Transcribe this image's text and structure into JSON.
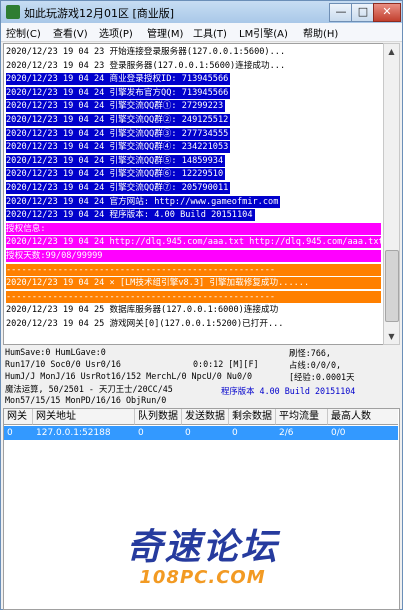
{
  "window": {
    "title": "如此玩游戏12月01区 [商业版]",
    "min": "—",
    "max": "□",
    "close": "✕"
  },
  "menu": [
    "控制(C)",
    "查看(V)",
    "选项(P)",
    "管理(M)",
    "工具(T)",
    "LM引擎(A)",
    "帮助(H)"
  ],
  "log": [
    {
      "text": "2020/12/23 19 04 23 开始连接登录服务器(127.0.0.1:5600)...",
      "fg": "#000000",
      "bg": ""
    },
    {
      "text": "2020/12/23 19 04 23 登录服务器(127.0.0.1:5600)连接成功...",
      "fg": "#000000",
      "bg": ""
    },
    {
      "text": "2020/12/23 19 04 24 商业登录授权ID: 713945566",
      "fg": "#ffffff",
      "bg": "#0000cc"
    },
    {
      "text": "2020/12/23 19 04 24 引擎发布官方QQ: 713945566",
      "fg": "#ffffff",
      "bg": "#0000cc"
    },
    {
      "text": "2020/12/23 19 04 24 引擎交流QQ群①: 27299223",
      "fg": "#ffffff",
      "bg": "#0000cc"
    },
    {
      "text": "2020/12/23 19 04 24 引擎交流QQ群②: 249125512",
      "fg": "#ffffff",
      "bg": "#0000cc"
    },
    {
      "text": "2020/12/23 19 04 24 引擎交流QQ群③: 277734555",
      "fg": "#ffffff",
      "bg": "#0000cc"
    },
    {
      "text": "2020/12/23 19 04 24 引擎交流QQ群④: 234221053",
      "fg": "#ffffff",
      "bg": "#0000cc"
    },
    {
      "text": "2020/12/23 19 04 24 引擎交流QQ群⑤: 14859934",
      "fg": "#ffffff",
      "bg": "#0000cc"
    },
    {
      "text": "2020/12/23 19 04 24 引擎交流QQ群⑥: 12229510",
      "fg": "#ffffff",
      "bg": "#0000cc"
    },
    {
      "text": "2020/12/23 19 04 24 引擎交流QQ群⑦: 205790011",
      "fg": "#ffffff",
      "bg": "#0000cc"
    },
    {
      "text": "2020/12/23 19 04 24 官方网站: http://www.gameofmir.com",
      "fg": "#ffffff",
      "bg": "#0000cc"
    },
    {
      "text": "2020/12/23 19 04 24 程序版本: 4.00 Build 20151104",
      "fg": "#ffffff",
      "bg": "#0000cc"
    },
    {
      "text": "授权信息:",
      "fg": "#ffffff",
      "bg": "#ff00ff"
    },
    {
      "text": "2020/12/23 19 04 24 http://dlq.945.com/aaa.txt http://dlq.945.com/aaa.txt",
      "fg": "#ffffff",
      "bg": "#ff00ff"
    },
    {
      "text": "授权天数:99/08/99999",
      "fg": "#ffffff",
      "bg": "#ff00ff"
    },
    {
      "text": "----------------------------------------------------",
      "fg": "#ffffff",
      "bg": "#ff8000"
    },
    {
      "text": "2020/12/23 19 04 24 × [LM技术组引擎v8.3] 引擎加载修复成功......",
      "fg": "#ffffff",
      "bg": "#ff8000"
    },
    {
      "text": "----------------------------------------------------",
      "fg": "#ffffff",
      "bg": "#ff8000"
    },
    {
      "text": "2020/12/23 19 04 25 数据库服务器(127.0.0.1:6000)连接成功",
      "fg": "#000000",
      "bg": ""
    },
    {
      "text": "2020/12/23 19 04 25 游戏网关[0](127.0.0.1:5200)已打开...",
      "fg": "#000000",
      "bg": ""
    }
  ],
  "status": {
    "line1": "HumSave:0 HumLGave:0",
    "line2": "Run17/10 Soc0/0 Usr0/16",
    "line2b": "0:0:12 [M][F]",
    "line3": "HumJ/J MonJ/16 UsrRot16/152 MerchL/0 NpcU/0 Nu0/0",
    "line4": "魔法运算, 50/2501 - 天刀王士/20CC/45",
    "line5": "Mon57/15/15 MonPD/16/16 ObjRun/0",
    "right1": "刷怪:766,",
    "right2": "占线:0/0/0,",
    "right3": "[经验:0.0001天",
    "version": "程序版本  4.00 Build 20151104"
  },
  "table": {
    "headers": [
      "网关",
      "网关地址",
      "队列数据",
      "发送数据",
      "剩余数据",
      "平均流量",
      "最高人数"
    ],
    "rows": [
      [
        "0",
        "127.0.0.1:52188",
        "0",
        "0",
        "0",
        "2/6",
        "0/0"
      ]
    ]
  },
  "watermark": {
    "main": "奇速论坛",
    "sub": "108PC.COM"
  }
}
